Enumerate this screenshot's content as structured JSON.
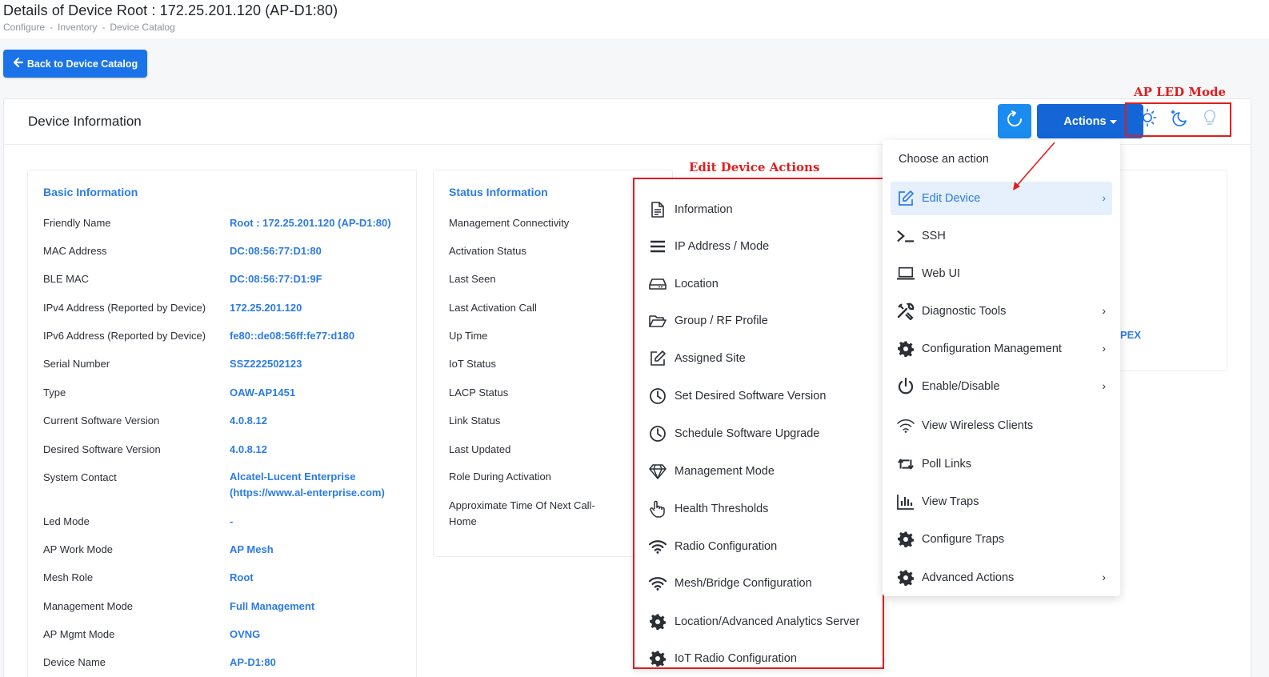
{
  "header": {
    "title": "Details of Device Root : 172.25.201.120 (AP-D1:80)",
    "breadcrumb": [
      "Configure",
      "Inventory",
      "Device Catalog"
    ],
    "breadcrumb_sep": "-"
  },
  "back_button": {
    "label": "Back to Device Catalog"
  },
  "card": {
    "title": "Device Information"
  },
  "toolbar": {
    "actions_label": "Actions",
    "led_annotation": "AP LED Mode"
  },
  "basic": {
    "title": "Basic Information",
    "rows": [
      {
        "label": "Friendly Name",
        "value": "Root : 172.25.201.120 (AP-D1:80)"
      },
      {
        "label": "MAC Address",
        "value": "DC:08:56:77:D1:80"
      },
      {
        "label": "BLE MAC",
        "value": "DC:08:56:77:D1:9F"
      },
      {
        "label": "IPv4 Address (Reported by Device)",
        "value": "172.25.201.120"
      },
      {
        "label": "IPv6 Address (Reported by Device)",
        "value": "fe80::de08:56ff:fe77:d180"
      },
      {
        "label": "Serial Number",
        "value": "SSZ222502123"
      },
      {
        "label": "Type",
        "value": "OAW-AP1451"
      },
      {
        "label": "Current Software Version",
        "value": "4.0.8.12"
      },
      {
        "label": "Desired Software Version",
        "value": "4.0.8.12"
      },
      {
        "label": "System Contact",
        "value": "Alcatel-Lucent Enterprise",
        "value2": "(https://www.al-enterprise.com)"
      },
      {
        "label": "Led Mode",
        "value": "-"
      },
      {
        "label": "AP Work Mode",
        "value": "AP Mesh"
      },
      {
        "label": "Mesh Role",
        "value": "Root"
      },
      {
        "label": "Management Mode",
        "value": "Full Management"
      },
      {
        "label": "AP Mgmt Mode",
        "value": "OVNG"
      },
      {
        "label": "Device Name",
        "value": "AP-D1:80"
      }
    ]
  },
  "status": {
    "title": "Status Information",
    "rows": [
      "Management Connectivity",
      "Activation Status",
      "Last Seen",
      "Last Activation Call",
      "Up Time",
      "IoT Status",
      "LACP Status",
      "Link Status",
      "Last Updated",
      "Role During Activation"
    ],
    "next_call_line1": "Approximate Time Of Next Call-",
    "next_call_line2": "Home"
  },
  "overflow_value": "PEX",
  "edit_menu": {
    "annotation": "Edit Device Actions",
    "items": [
      {
        "label": "Information",
        "icon": "document-icon"
      },
      {
        "label": "IP Address / Mode",
        "icon": "list-icon"
      },
      {
        "label": "Location",
        "icon": "drive-icon"
      },
      {
        "label": "Group / RF Profile",
        "icon": "folder-open-icon"
      },
      {
        "label": "Assigned Site",
        "icon": "edit-icon"
      },
      {
        "label": "Set Desired Software Version",
        "icon": "clock-icon"
      },
      {
        "label": "Schedule Software Upgrade",
        "icon": "clock-icon"
      },
      {
        "label": "Management Mode",
        "icon": "diamond-icon"
      },
      {
        "label": "Health Thresholds",
        "icon": "hand-pointer-icon"
      },
      {
        "label": "Radio Configuration",
        "icon": "wifi-icon"
      },
      {
        "label": "Mesh/Bridge Configuration",
        "icon": "wifi-icon"
      },
      {
        "label": "Location/Advanced Analytics Server",
        "icon": "gear-icon"
      },
      {
        "label": "IoT Radio Configuration",
        "icon": "gear-icon"
      }
    ]
  },
  "action_menu": {
    "heading": "Choose an action",
    "items": [
      {
        "label": "Edit Device",
        "icon": "edit-icon",
        "submenu": true,
        "active": true
      },
      {
        "label": "SSH",
        "icon": "terminal-icon",
        "submenu": false
      },
      {
        "label": "Web UI",
        "icon": "laptop-icon",
        "submenu": false
      },
      {
        "label": "Diagnostic Tools",
        "icon": "tools-icon",
        "submenu": true
      },
      {
        "label": "Configuration Management",
        "icon": "gear-icon",
        "submenu": true
      },
      {
        "label": "Enable/Disable",
        "icon": "power-icon",
        "submenu": true
      },
      {
        "label": "View Wireless Clients",
        "icon": "wifi-icon",
        "submenu": false
      },
      {
        "label": "Poll Links",
        "icon": "retweet-icon",
        "submenu": false
      },
      {
        "label": "View Traps",
        "icon": "bar-chart-icon",
        "submenu": false
      },
      {
        "label": "Configure Traps",
        "icon": "gear-icon",
        "submenu": false
      },
      {
        "label": "Advanced Actions",
        "icon": "gear-icon",
        "submenu": true
      }
    ]
  },
  "colors": {
    "primary": "#1466d6",
    "link": "#2c7be5",
    "annotation": "#e01e1e"
  }
}
